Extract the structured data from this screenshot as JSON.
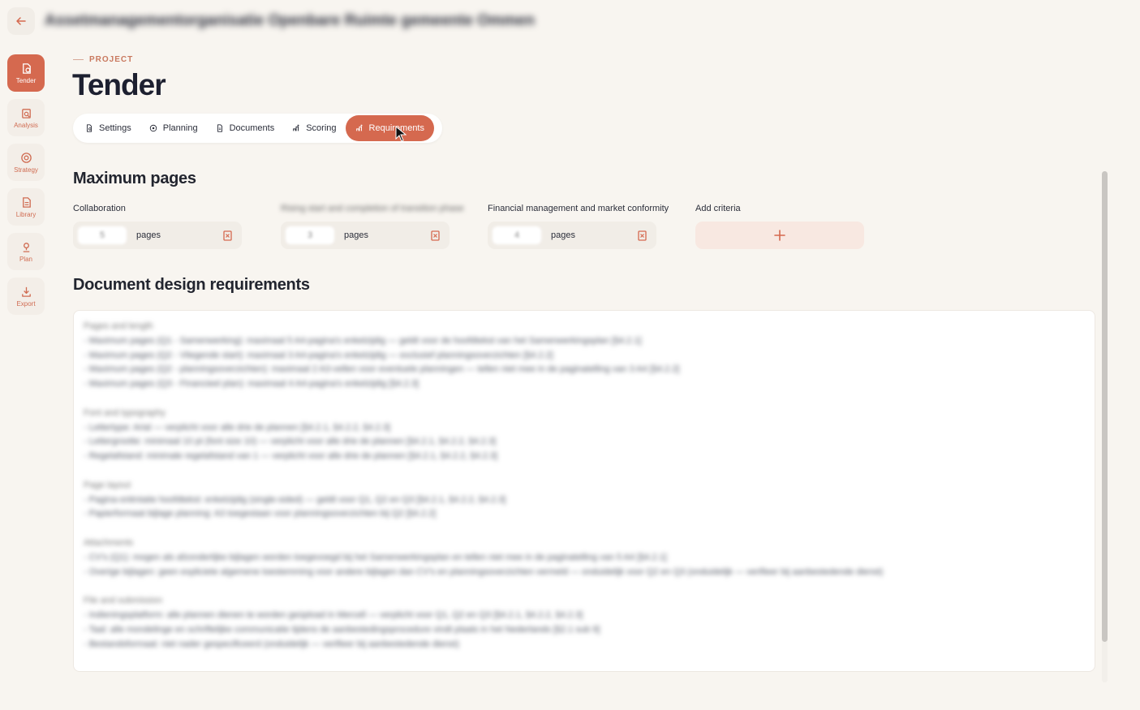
{
  "topbar": {
    "org_title": "Assetmanagementorganisatie Openbare Ruimte gemeente Ommen"
  },
  "sidebar": {
    "items": [
      {
        "label": "Tender",
        "icon": "tender-icon",
        "active": true
      },
      {
        "label": "Analysis",
        "icon": "analysis-icon",
        "active": false
      },
      {
        "label": "Strategy",
        "icon": "strategy-icon",
        "active": false
      },
      {
        "label": "Library",
        "icon": "library-icon",
        "active": false
      },
      {
        "label": "Plan",
        "icon": "plan-icon",
        "active": false
      },
      {
        "label": "Export",
        "icon": "export-icon",
        "active": false
      }
    ]
  },
  "header": {
    "eyebrow": "PROJECT",
    "title": "Tender"
  },
  "tabs": [
    {
      "label": "Settings",
      "icon": "settings-icon",
      "active": false
    },
    {
      "label": "Planning",
      "icon": "planning-icon",
      "active": false
    },
    {
      "label": "Documents",
      "icon": "documents-icon",
      "active": false
    },
    {
      "label": "Scoring",
      "icon": "scoring-icon",
      "active": false
    },
    {
      "label": "Requirements",
      "icon": "requirements-icon",
      "active": true
    }
  ],
  "max_pages": {
    "title": "Maximum pages",
    "criteria": [
      {
        "label": "Collaboration",
        "value": "5",
        "unit": "pages"
      },
      {
        "label": "Rising start and completion of transition phase",
        "value": "3",
        "unit": "pages"
      },
      {
        "label": "Financial management and market conformity",
        "value": "4",
        "unit": "pages"
      }
    ],
    "add_label": "Add criteria"
  },
  "doc_requirements": {
    "title": "Document design requirements",
    "blocks": [
      {
        "heading": "Pages and length",
        "lines": [
          "- Maximum pages (Q1 - Samenwerking): maximaal 5 A4-pagina's enkelzijdig — geldt voor de hoofdtekst van het Samenwerkingsplan [§4.2.1]",
          "- Maximum pages (Q2 - Vliegende start): maximaal 3 A4-pagina's enkelzijdig — exclusief planningsoverzichten [§4.2.2]",
          "- Maximum pages (Q2 - planningsoverzichten): maximaal 2 A3-vellen voor eventuele planningen — tellen niet mee in de paginatelling van 3 A4 [§4.2.2]",
          "- Maximum pages (Q3 - Financieel plan): maximaal 4 A4-pagina's enkelzijdig [§4.2.3]"
        ]
      },
      {
        "heading": "Font and typography",
        "lines": [
          "- Lettertype: Arial — verplicht voor alle drie de plannen [§4.2.1, §4.2.2, §4.2.3]",
          "- Lettergrootte: minimaal 10 pt (font size 10) — verplicht voor alle drie de plannen [§4.2.1, §4.2.2, §4.2.3]",
          "- Regelafstand: minimale regelafstand van 1 — verplicht voor alle drie de plannen [§4.2.1, §4.2.2, §4.2.3]"
        ]
      },
      {
        "heading": "Page layout",
        "lines": [
          "- Pagina-oriëntatie hoofdtekst: enkelzijdig (single-sided) — geldt voor Q1, Q2 en Q3 [§4.2.1, §4.2.2, §4.2.3]",
          "- Papierformaat bijlage planning: A3 toegestaan voor planningsoverzichten bij Q2 [§4.2.2]"
        ]
      },
      {
        "heading": "Attachments",
        "lines": [
          "- CV's (Q1): mogen als afzonderlijke bijlagen worden toegevoegd bij het Samenwerkingsplan en tellen niet mee in de paginatelling van 5 A4 [§4.2.1]",
          "- Overige bijlagen: geen expliciete algemene toestemming voor andere bijlagen dan CV's en planningsoverzichten vermeld — onduidelijk voor Q2 en Q3 (onduidelijk — verifieer bij aanbestedende dienst)"
        ]
      },
      {
        "heading": "File and submission",
        "lines": [
          "- Indieningsplatform: alle plannen dienen te worden geüpload in Mercell — verplicht voor Q1, Q2 en Q3 [§4.2.1, §4.2.2, §4.2.3]",
          "- Taal: alle mondelinge en schriftelijke communicatie tijdens de aanbestedingsprocedure vindt plaats in het Nederlands [§2.1 sub 9]",
          "- Bestandsformaat: niet nader gespecificeerd (onduidelijk — verifieer bij aanbestedende dienst)"
        ]
      }
    ]
  },
  "colors": {
    "accent": "#d5694f",
    "background": "#f8f5f0"
  }
}
